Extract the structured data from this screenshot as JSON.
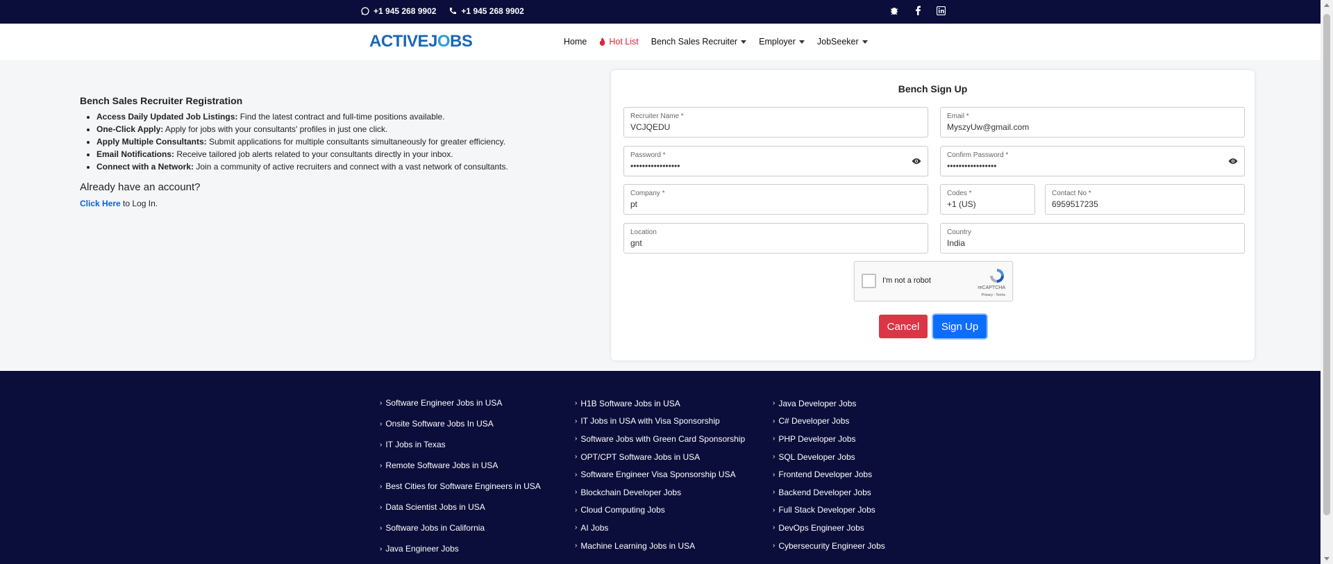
{
  "topbar": {
    "whatsapp": "+1 945 268 9902",
    "phone": "+1 945 268 9902",
    "socials": [
      "bug-icon",
      "facebook-icon",
      "linkedin-icon"
    ]
  },
  "navbar": {
    "logo_a": "ACTIVEJ",
    "logo_o": "O",
    "logo_b": "BS",
    "items": {
      "home": "Home",
      "hotlist": "Hot List",
      "bench": "Bench Sales Recruiter",
      "employer": "Employer",
      "jobseeker": "JobSeeker"
    }
  },
  "info": {
    "title": "Bench Sales Recruiter Registration",
    "points": [
      {
        "bold": "Access Daily Updated Job Listings:",
        "text": " Find the latest contract and full-time positions available."
      },
      {
        "bold": "One-Click Apply:",
        "text": " Apply for jobs with your consultants' profiles in just one click."
      },
      {
        "bold": "Apply Multiple Consultants:",
        "text": " Submit applications for multiple consultants simultaneously for greater efficiency."
      },
      {
        "bold": "Email Notifications:",
        "text": " Receive tailored job alerts related to your consultants directly in your inbox."
      },
      {
        "bold": "Connect with a Network:",
        "text": " Join a community of active recruiters and connect with a vast network of consultants."
      }
    ],
    "already": "Already have an account?",
    "click_here": "Click Here",
    "to_login": " to Log In."
  },
  "form": {
    "title": "Bench Sign Up",
    "recruiter_name": {
      "label": "Recruiter Name *",
      "value": "VCJQEDU"
    },
    "email": {
      "label": "Email *",
      "value": "MyszyUw@gmail.com"
    },
    "password": {
      "label": "Password *",
      "value": "•••••••••••••••••"
    },
    "confirm_password": {
      "label": "Confirm Password *",
      "value": "•••••••••••••••••"
    },
    "company": {
      "label": "Company *",
      "value": "pt"
    },
    "codes": {
      "label": "Codes *",
      "value": "+1 (US)"
    },
    "contact": {
      "label": "Contact No *",
      "value": "6959517235"
    },
    "location": {
      "label": "Location",
      "value": "gnt"
    },
    "country": {
      "label": "Country",
      "value": "India"
    },
    "captcha": {
      "text": "I'm not a robot",
      "brand": "reCAPTCHA",
      "terms": "Privacy - Terms"
    },
    "cancel": "Cancel",
    "signup": "Sign Up"
  },
  "footer": {
    "col1": [
      "Software Engineer Jobs in USA",
      "Onsite Software Jobs In USA",
      "IT Jobs in Texas",
      "Remote Software Jobs in USA",
      "Best Cities for Software Engineers in USA",
      "Data Scientist Jobs in USA",
      "Software Jobs in California",
      "Java Engineer Jobs"
    ],
    "col2": [
      "H1B Software Jobs in USA",
      "IT Jobs in USA with Visa Sponsorship",
      "Software Jobs with Green Card Sponsorship",
      "OPT/CPT Software Jobs in USA",
      "Software Engineer Visa Sponsorship USA",
      "Blockchain Developer Jobs",
      "Cloud Computing Jobs",
      "AI Jobs",
      "Machine Learning Jobs in USA"
    ],
    "col3": [
      "Java Developer Jobs",
      "C# Developer Jobs",
      "PHP Developer Jobs",
      "SQL Developer Jobs",
      "Frontend Developer Jobs",
      "Backend Developer Jobs",
      "Full Stack Developer Jobs",
      "DevOps Engineer Jobs",
      "Cybersecurity Engineer Jobs"
    ]
  }
}
